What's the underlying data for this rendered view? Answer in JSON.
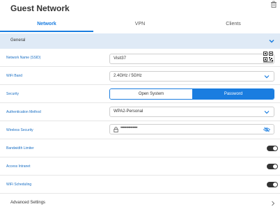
{
  "page": {
    "title": "Guest Network"
  },
  "tabs": [
    {
      "label": "Network",
      "active": true
    },
    {
      "label": "VPN",
      "active": false
    },
    {
      "label": "Clients",
      "active": false
    }
  ],
  "section": {
    "title": "General",
    "expanded": true
  },
  "fields": {
    "ssid": {
      "label": "Network Name (SSID)",
      "value": "Visit37"
    },
    "band": {
      "label": "WiFi Band",
      "value": "2.4GHz / 5GHz"
    },
    "security": {
      "label": "Security",
      "options": [
        "Open System",
        "Password"
      ],
      "selected": "Password"
    },
    "auth": {
      "label": "Authentication Method",
      "value": "WPA2-Personal"
    },
    "wireless_security": {
      "label": "Wireless Security",
      "value": "•••••••••••••••"
    },
    "bandwidth_limiter": {
      "label": "Bandwidth Limiter",
      "enabled": false
    },
    "access_intranet": {
      "label": "Access Intranet",
      "enabled": false
    },
    "wifi_scheduling": {
      "label": "WiFi Scheduling",
      "enabled": false
    }
  },
  "advanced": {
    "label": "Advanced Settings"
  },
  "colors": {
    "accent": "#1a7de0",
    "section_bg": "#dfeaf6",
    "toggle": "#333333"
  },
  "icons": [
    "trash-icon",
    "chevron-down-icon",
    "qr-code-icon",
    "lock-icon",
    "eye-off-icon",
    "chevron-right-icon"
  ]
}
